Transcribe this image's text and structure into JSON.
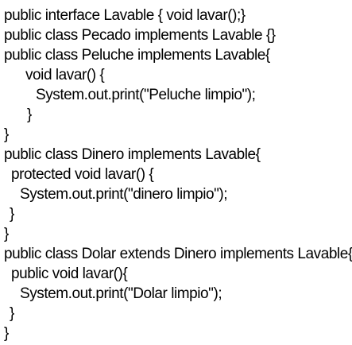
{
  "code_lines": [
    "public interface Lavable { void lavar();}",
    "public class Pecado implements Lavable {}",
    "public class Peluche implements Lavable{",
    "void lavar() {",
    "System.out.print(\"Peluche limpio\");",
    "}",
    "}",
    "public class Dinero implements Lavable{",
    "protected void lavar() {",
    "System.out.print(\"dinero limpio\");",
    "}",
    "}",
    "public class Dolar extends Dinero implements Lavable{",
    "public void lavar(){",
    "System.out.print(\"Dolar limpio\");",
    "}",
    "}"
  ]
}
